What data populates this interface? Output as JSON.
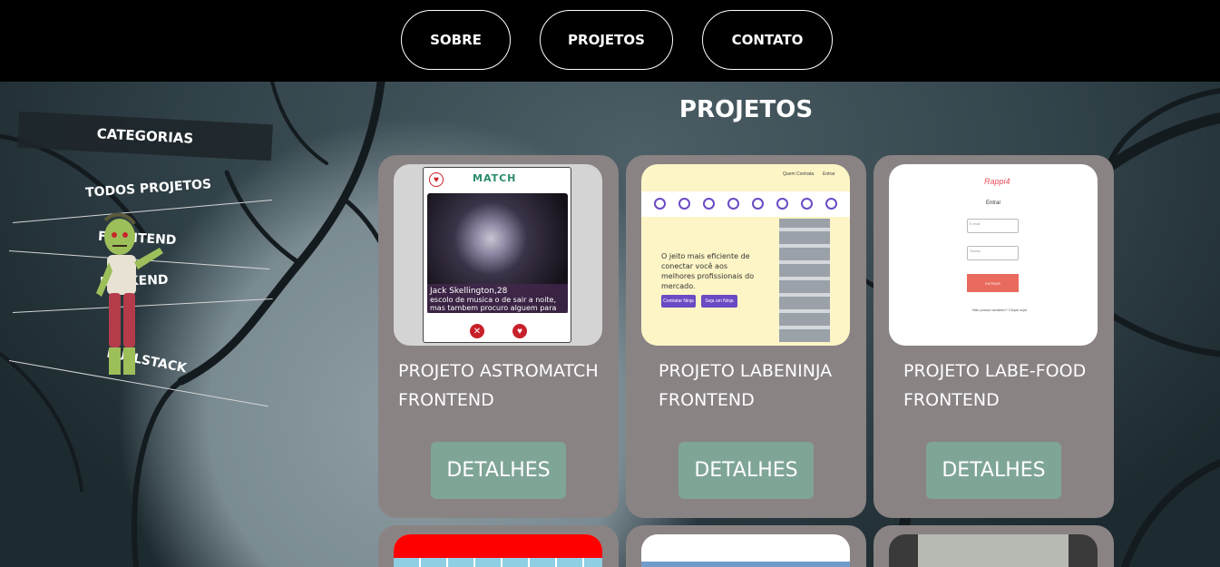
{
  "nav": {
    "sobre": "SOBRE",
    "projetos": "PROJETOS",
    "contato": "CONTATO"
  },
  "sidebar": {
    "title": "CATEGORIAS",
    "items": [
      "TODOS PROJETOS",
      "FRONTEND",
      "BACKEND",
      "FULLSTACK"
    ]
  },
  "page_title": "PROJETOS",
  "cards": [
    {
      "title": "PROJETO ASTROMATCH FRONTEND",
      "button": "DETALHES",
      "thumb": {
        "logo": "MATCH",
        "caption_name": "Jack Skellington,28",
        "caption_text": "escolo de musica o de sair a noite, mas tambem procuro alguem para me preencher"
      }
    },
    {
      "title": "PROJETO LABENINJA FRONTEND",
      "button": "DETALHES",
      "thumb": {
        "nav_1": "Quem Contrata",
        "nav_2": "Entrar",
        "hero": "O jeito mais eficiente de conectar você aos melhores profissionais do mercado.",
        "btn_1": "Contratar Ninja",
        "btn_2": "Seja um Ninja"
      }
    },
    {
      "title": "PROJETO LABE-FOOD FRONTEND",
      "button": "DETALHES",
      "thumb": {
        "logo": "Rappi4",
        "heading": "Entrar",
        "email_placeholder": "E-mail",
        "password_placeholder": "Senha",
        "submit": "ENTRAR",
        "register": "Não possui cadastro? Clique aqui."
      }
    }
  ],
  "colors": {
    "card_bg": "#8a8384",
    "button_bg": "#7fa597",
    "topbar_bg": "#000000"
  },
  "icons": [
    "zombie-mascot",
    "heart-icon",
    "close-icon"
  ]
}
